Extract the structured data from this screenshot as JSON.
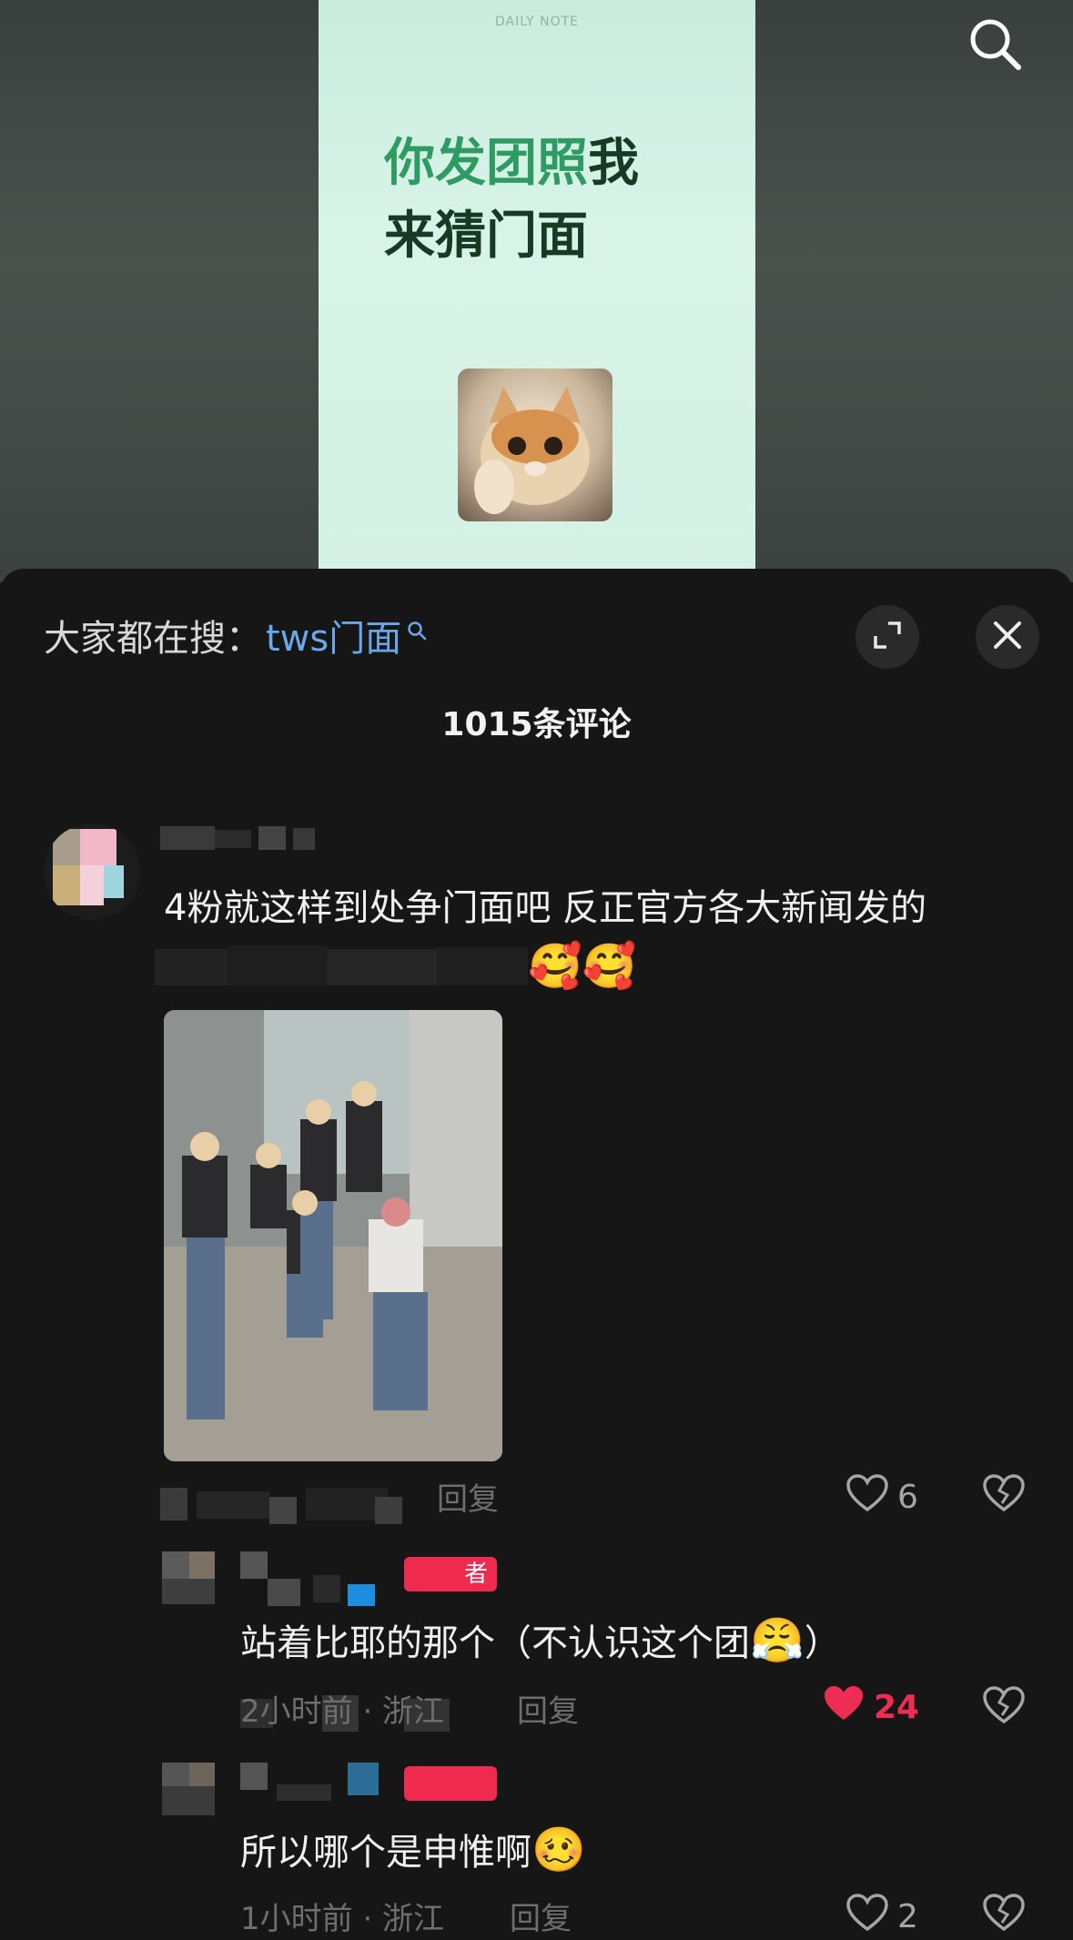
{
  "video": {
    "brand": "DAILY NOTE",
    "title_line1_highlight": "你发团照",
    "title_line1_rest": "我",
    "title_line2": "来猜门面"
  },
  "icons": {
    "search": "search-icon",
    "trend_search": "small-search-icon",
    "expand": "expand-icon",
    "close": "close-icon",
    "like": "heart-icon",
    "dislike": "broken-heart-icon"
  },
  "sheet": {
    "trend_prefix": "大家都在搜：",
    "trend_query": "tws门面",
    "comment_count": "1015条评论"
  },
  "comments": [
    {
      "text_line1": "4粉就这样到处争门面吧 反正官方各大新闻发的",
      "emojis": "🥰🥰",
      "reply": "回复",
      "likes": "6"
    },
    {
      "badge": "者",
      "text": "站着比耶的那个（不认识这个团",
      "emoji": "😤",
      "text_end": "）",
      "time": "2小时前 · 浙江",
      "reply": "回复",
      "likes": "24"
    },
    {
      "text": "所以哪个是申惟啊",
      "emoji": "🥴",
      "time": "1小时前 · 浙江",
      "reply": "回复",
      "likes": "2"
    }
  ],
  "colors": {
    "accent_link": "#6aa8ea",
    "like_red": "#ee2d55",
    "badge_red": "#f0294f",
    "sheet_bg": "#161616"
  }
}
